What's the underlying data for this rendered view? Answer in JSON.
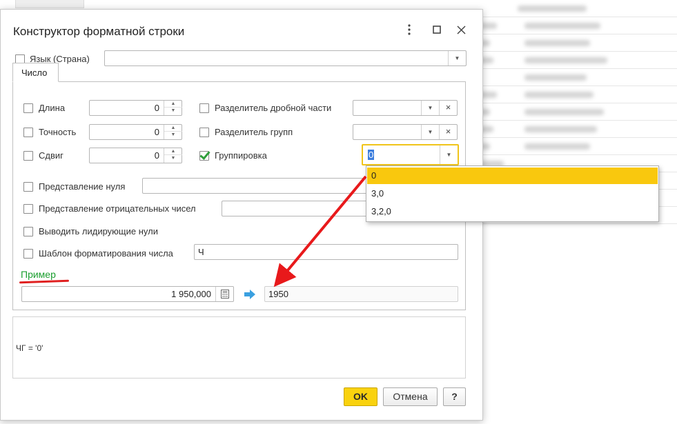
{
  "dialog": {
    "title": "Конструктор форматной строки",
    "menu_icon": "more-vertical-icon",
    "maximize_icon": "maximize-icon",
    "close_icon": "close-icon"
  },
  "language": {
    "label": "Язык (Страна)",
    "value": "",
    "checked": false
  },
  "tab": {
    "label": "Число"
  },
  "left_fields": [
    {
      "label": "Длина",
      "value": "0"
    },
    {
      "label": "Точность",
      "value": "0"
    },
    {
      "label": "Сдвиг",
      "value": "0"
    }
  ],
  "right_fields": [
    {
      "label": "Разделитель дробной части",
      "value": ""
    },
    {
      "label": "Разделитель групп",
      "value": ""
    },
    {
      "label": "Группировка",
      "value": "0",
      "checked": true
    }
  ],
  "zero_repr": {
    "label": "Представление нуля",
    "value": ""
  },
  "negative_repr": {
    "label": "Представление отрицательных чисел",
    "value": ""
  },
  "leading_zeros": {
    "label": "Выводить лидирующие нули"
  },
  "template": {
    "label": "Шаблон форматирования числа",
    "value": "Ч"
  },
  "example": {
    "label": "Пример",
    "input_value": "1 950,000",
    "output_value": "1950",
    "label_color": "#1a9e2e",
    "underline_color": "#e02020"
  },
  "grouping_dropdown": {
    "options": [
      "0",
      "3,0",
      "3,2,0"
    ],
    "selected": "0"
  },
  "info_text": "ЧГ = '0'",
  "buttons": {
    "ok": "OK",
    "cancel": "Отмена",
    "help": "?"
  },
  "colors": {
    "accent": "#f9c80e",
    "arrow": "#e8191b",
    "check": "#2e9e3a"
  }
}
